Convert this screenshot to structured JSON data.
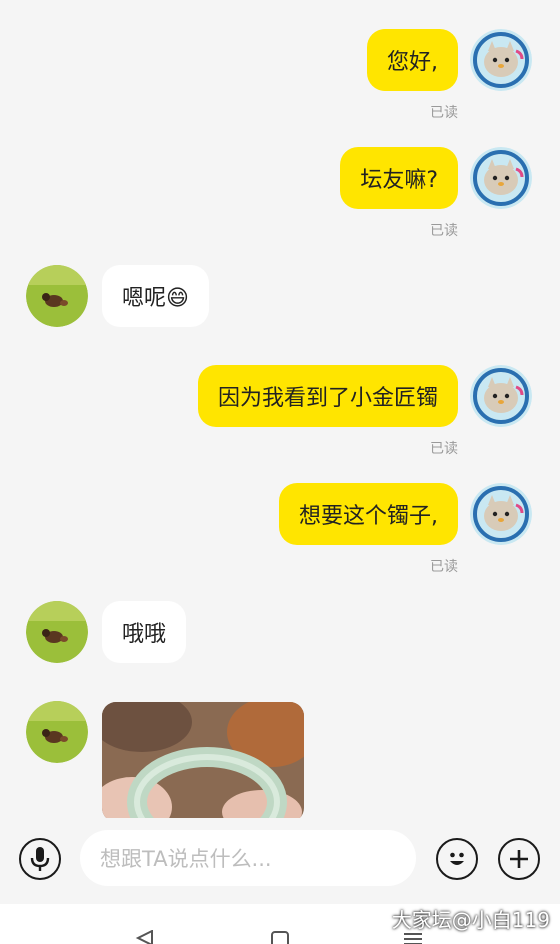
{
  "messages": [
    {
      "from": "me",
      "text": "您好,",
      "read": "已读"
    },
    {
      "from": "me",
      "text": "坛友嘛?",
      "read": "已读"
    },
    {
      "from": "other",
      "text": "嗯呢😄"
    },
    {
      "from": "me",
      "text": "因为我看到了小金匠镯",
      "read": "已读"
    },
    {
      "from": "me",
      "text": "想要这个镯子,",
      "read": "已读"
    },
    {
      "from": "other",
      "text": "哦哦"
    },
    {
      "from": "other",
      "type": "image",
      "image_desc": "photo"
    }
  ],
  "input": {
    "placeholder": "想跟TA说点什么..."
  },
  "icons": {
    "voice": "microphone-icon",
    "emoji": "emoji-icon",
    "add": "plus-icon",
    "my_avatar": "cartoon-cat-avatar",
    "their_avatar": "dog-on-grass-avatar"
  },
  "nav": [
    "back",
    "home",
    "recents"
  ],
  "watermark": "大家坛@小白119",
  "colors": {
    "my_bubble": "#ffe500",
    "their_bubble": "#ffffff",
    "background": "#f5f5f5"
  }
}
